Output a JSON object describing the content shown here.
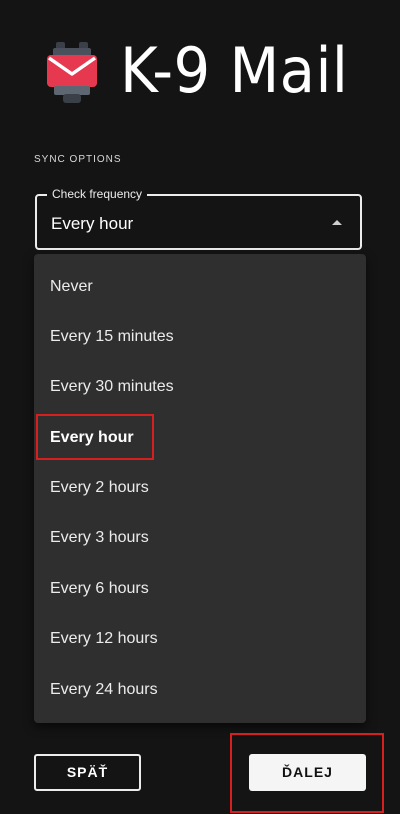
{
  "app": {
    "title": "K-9 Mail",
    "logo_icon": "k9-mail-logo-icon"
  },
  "section": {
    "label": "SYNC OPTIONS"
  },
  "field": {
    "label": "Check frequency",
    "value": "Every hour",
    "arrow_icon": "dropdown-up-arrow-icon"
  },
  "menu": {
    "items": [
      {
        "label": "Never"
      },
      {
        "label": "Every 15 minutes"
      },
      {
        "label": "Every 30 minutes"
      },
      {
        "label": "Every hour",
        "selected": true
      },
      {
        "label": "Every 2 hours"
      },
      {
        "label": "Every 3 hours"
      },
      {
        "label": "Every 6 hours"
      },
      {
        "label": "Every 12 hours"
      },
      {
        "label": "Every 24 hours"
      }
    ]
  },
  "buttons": {
    "back_label": "SPÄŤ",
    "next_label": "ĎALEJ"
  },
  "colors": {
    "background": "#141414",
    "menu_background": "#2f2f2f",
    "highlight": "#d61f1f",
    "logo_red": "#e63950"
  }
}
